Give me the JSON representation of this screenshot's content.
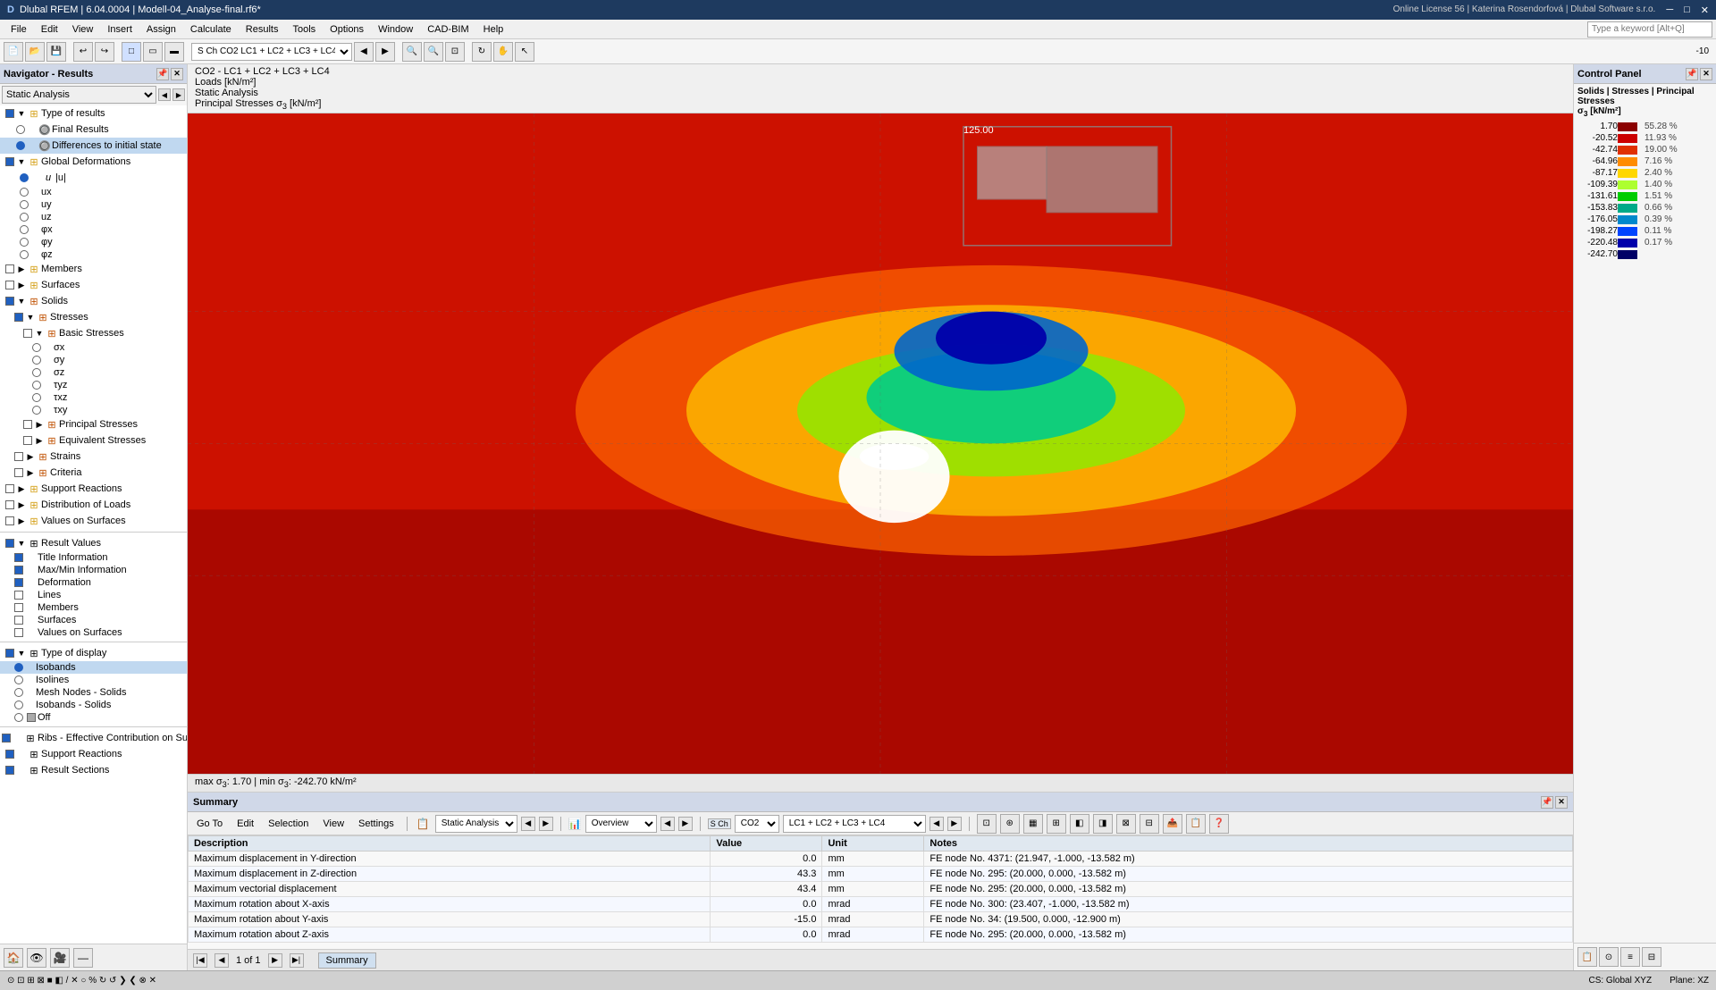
{
  "app": {
    "title": "Dlubal RFEM | 6.04.0004 | Modell-04_Analyse-final.rf6*",
    "license": "Online License 56 | Katerina Rosendorfová | Dlubal Software s.r.o."
  },
  "menubar": {
    "items": [
      "File",
      "Edit",
      "View",
      "Insert",
      "Assign",
      "Calculate",
      "Results",
      "Tools",
      "Options",
      "Window",
      "CAD-BIM",
      "Help"
    ]
  },
  "left_panel": {
    "title": "Navigator - Results",
    "dropdown_value": "Static Analysis",
    "tree": {
      "type_of_results": {
        "label": "Type of results",
        "children": {
          "final_results": "Final Results",
          "differences": "Differences to initial state"
        }
      },
      "global_deformations": {
        "label": "Global Deformations",
        "children": [
          "u",
          "ux",
          "uy",
          "uz",
          "φx",
          "φy",
          "φz"
        ]
      },
      "members": "Members",
      "surfaces": "Surfaces",
      "solids": {
        "label": "Solids",
        "children": {
          "stresses": {
            "label": "Stresses",
            "children": {
              "basic_stresses": {
                "label": "Basic Stresses",
                "children": [
                  "σx",
                  "σy",
                  "σz",
                  "τyz",
                  "τxz",
                  "τxy"
                ]
              },
              "principal_stresses": "Principal Stresses",
              "equivalent_stresses": "Equivalent Stresses"
            }
          },
          "strains": "Strains",
          "criteria": "Criteria"
        }
      },
      "support_reactions": "Support Reactions",
      "distribution_of_loads": "Distribution of Loads",
      "values_on_surfaces": "Values on Surfaces"
    },
    "result_values": {
      "label": "Result Values",
      "items": [
        {
          "label": "Title Information",
          "checked": true
        },
        {
          "label": "Max/Min Information",
          "checked": true
        },
        {
          "label": "Deformation",
          "checked": true
        },
        {
          "label": "Lines",
          "checked": false
        },
        {
          "label": "Members",
          "checked": false
        },
        {
          "label": "Surfaces",
          "checked": false
        },
        {
          "label": "Values on Surfaces",
          "checked": false
        }
      ]
    },
    "type_of_display": {
      "label": "Type of display",
      "options": [
        {
          "label": "Isobands",
          "selected": true
        },
        {
          "label": "Isolines",
          "selected": false
        },
        {
          "label": "Mesh Nodes - Solids",
          "selected": false
        },
        {
          "label": "Isobands - Solids",
          "selected": false
        },
        {
          "label": "Off",
          "selected": false
        }
      ]
    },
    "bottom_items": [
      "Ribs - Effective Contribution on Surfa...",
      "Support Reactions",
      "Result Sections"
    ]
  },
  "info_bar": {
    "line1": "CO2 - LC1 + LC2 + LC3 + LC4",
    "line2": "Loads [kN/m²]",
    "line3": "Static Analysis",
    "line4": "Principal Stresses σ3 [kN/m²]"
  },
  "status_bar": {
    "text": "max σ3: 1.70 | min σ3: -242.70 kN/m²"
  },
  "legend": {
    "title": "Solids | Stresses | Principal Stresses σ3 [kN/m²]",
    "items": [
      {
        "value": "1.70",
        "color": "#8b0000",
        "pct": "55.28 %"
      },
      {
        "value": "-20.52",
        "color": "#cc0000",
        "pct": "11.93 %"
      },
      {
        "value": "-42.74",
        "color": "#e03000",
        "pct": "19.00 %"
      },
      {
        "value": "-64.96",
        "color": "#ff8c00",
        "pct": "7.16 %"
      },
      {
        "value": "-87.17",
        "color": "#ffd700",
        "pct": "2.40 %"
      },
      {
        "value": "-109.39",
        "color": "#adff2f",
        "pct": "1.40 %"
      },
      {
        "value": "-131.61",
        "color": "#00cc00",
        "pct": "1.51 %"
      },
      {
        "value": "-153.83",
        "color": "#00aa88",
        "pct": "0.66 %"
      },
      {
        "value": "-176.05",
        "color": "#0088cc",
        "pct": "0.39 %"
      },
      {
        "value": "-198.27",
        "color": "#0044ff",
        "pct": "0.11 %"
      },
      {
        "value": "-220.48",
        "color": "#0000aa",
        "pct": "0.17 %"
      },
      {
        "value": "-242.70",
        "color": "#000066",
        "pct": ""
      }
    ]
  },
  "summary": {
    "title": "Summary",
    "tabs": [
      "Go To",
      "Edit",
      "Selection",
      "View",
      "Settings"
    ],
    "combo1": "Static Analysis",
    "combo2": "Overview",
    "load_combo": "LC1 + LC2 + LC3 + LC4",
    "table": {
      "headers": [
        "Description",
        "Value",
        "Unit",
        "Notes"
      ],
      "rows": [
        {
          "desc": "Maximum displacement in Y-direction",
          "value": "0.0",
          "unit": "mm",
          "note": "FE node No. 4371: (21.947, -1.000, -13.582 m)"
        },
        {
          "desc": "Maximum displacement in Z-direction",
          "value": "43.3",
          "unit": "mm",
          "note": "FE node No. 295: (20.000, 0.000, -13.582 m)"
        },
        {
          "desc": "Maximum vectorial displacement",
          "value": "43.4",
          "unit": "mm",
          "note": "FE node No. 295: (20.000, 0.000, -13.582 m)"
        },
        {
          "desc": "Maximum rotation about X-axis",
          "value": "0.0",
          "unit": "mrad",
          "note": "FE node No. 300: (23.407, -1.000, -13.582 m)"
        },
        {
          "desc": "Maximum rotation about Y-axis",
          "value": "-15.0",
          "unit": "mrad",
          "note": "FE node No. 34: (19.500, 0.000, -12.900 m)"
        },
        {
          "desc": "Maximum rotation about Z-axis",
          "value": "0.0",
          "unit": "mrad",
          "note": "FE node No. 295: (20.000, 0.000, -13.582 m)"
        }
      ]
    },
    "footer": {
      "page_info": "1 of 1",
      "tab_label": "Summary"
    }
  },
  "bottom_status": {
    "cs": "CS: Global XYZ",
    "plane": "Plane: XZ"
  },
  "toolbar2": {
    "combo": "S Ch  CO2   LC1 + LC2 + LC3 + LC4"
  }
}
